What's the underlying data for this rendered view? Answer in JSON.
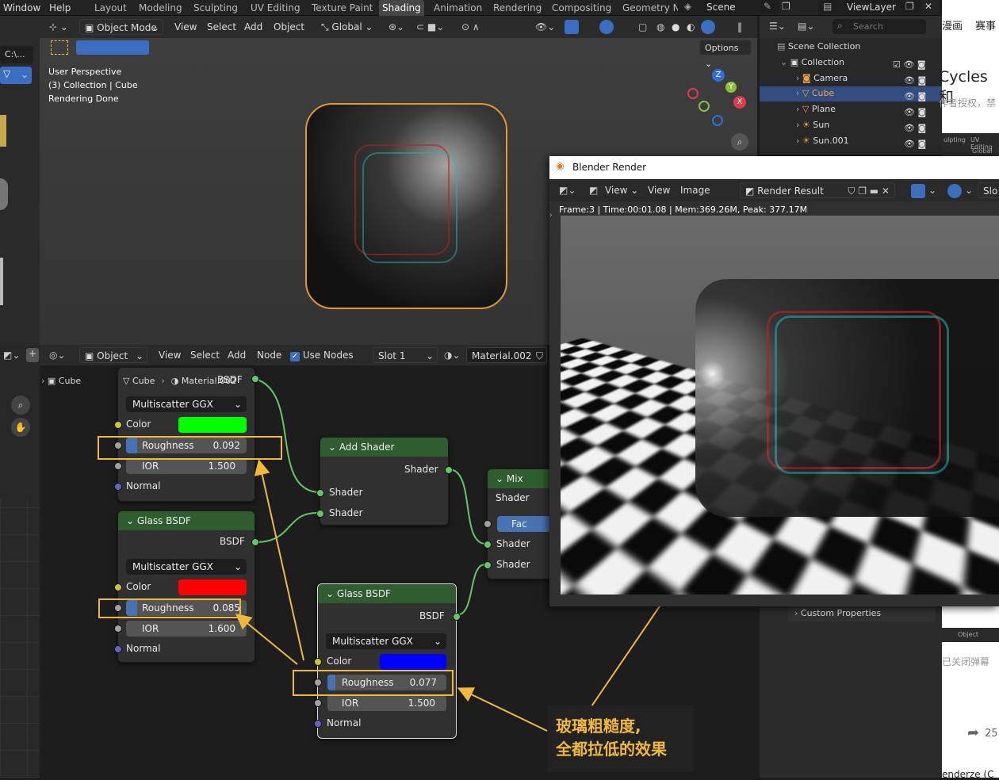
{
  "topbar": {
    "menus": [
      "Window",
      "Help"
    ],
    "workspaces": [
      "Layout",
      "Modeling",
      "Sculpting",
      "UV Editing",
      "Texture Paint",
      "Shading",
      "Animation",
      "Rendering",
      "Compositing",
      "Geometry N"
    ],
    "active_workspace": "Shading",
    "scene": "Scene",
    "view_layer": "ViewLayer"
  },
  "viewport": {
    "mode": "Object Mode",
    "menus": [
      "View",
      "Select",
      "Add",
      "Object"
    ],
    "orientation": "Global",
    "options": "Options",
    "overlay_lines": [
      "User Perspective",
      "(3) Collection | Cube",
      "Rendering Done"
    ],
    "gizmo": {
      "x": "X",
      "y": "Y",
      "z": "Z"
    }
  },
  "left_panel": {
    "path": "C:\\..."
  },
  "outliner": {
    "search_placeholder": "Search",
    "items": [
      {
        "label": "Scene Collection"
      },
      {
        "label": "Collection"
      },
      {
        "label": "Camera"
      },
      {
        "label": "Cube"
      },
      {
        "label": "Plane"
      },
      {
        "label": "Sun"
      },
      {
        "label": "Sun.001"
      }
    ]
  },
  "node_editor": {
    "editor_type": "Object",
    "menus": [
      "View",
      "Select",
      "Add",
      "Node"
    ],
    "use_nodes": "Use Nodes",
    "slot": "Slot 1",
    "material": "Material.002",
    "breadcrumb": [
      "Cube",
      "Cube",
      "Material.002"
    ],
    "nodes": {
      "top_glass": {
        "output": "BSDF",
        "distribution": "Multiscatter GGX",
        "color_label": "Color",
        "roughness_label": "Roughness",
        "roughness": "0.092",
        "ior_label": "IOR",
        "ior": "1.500",
        "normal_label": "Normal",
        "color": "#00ff00"
      },
      "glass_red": {
        "title": "Glass BSDF",
        "output": "BSDF",
        "distribution": "Multiscatter GGX",
        "color_label": "Color",
        "roughness_label": "Roughness",
        "roughness": "0.085",
        "ior_label": "IOR",
        "ior": "1.600",
        "normal_label": "Normal",
        "color": "#ff0000"
      },
      "glass_blue": {
        "title": "Glass BSDF",
        "output": "BSDF",
        "distribution": "Multiscatter GGX",
        "color_label": "Color",
        "roughness_label": "Roughness",
        "roughness": "0.077",
        "ior_label": "IOR",
        "ior": "1.500",
        "normal_label": "Normal",
        "color": "#0000ff"
      },
      "add_shader": {
        "title": "Add Shader",
        "output": "Shader",
        "in1": "Shader",
        "in2": "Shader"
      },
      "mix_shader": {
        "title": "Mix Shader",
        "fac": "Fac",
        "in1": "Shader",
        "in2": "Shader"
      }
    }
  },
  "render_window": {
    "title": "Blender Render",
    "menus": [
      "View",
      "View",
      "Image"
    ],
    "result": "Render Result",
    "slot": "Slo",
    "status": "Frame:3 | Time:00:01.08 | Mem:369.26M, Peak: 377.17M"
  },
  "properties": {
    "custom_properties": "Custom Properties"
  },
  "annotation": {
    "line1": "玻璃粗糙度,",
    "line2": "全都拉低的效果",
    "color": "#f0b93a"
  },
  "web_bg": {
    "t1": "漫画",
    "t2": "赛事",
    "t3": "Cycles和",
    "t4": "作者授权，禁",
    "t5": "已关闭弹幕",
    "t6": "25",
    "t7": "enderze (C",
    "t8": "ulpting",
    "t9": "UV Editing",
    "t10": "Global",
    "t11": "Object"
  }
}
